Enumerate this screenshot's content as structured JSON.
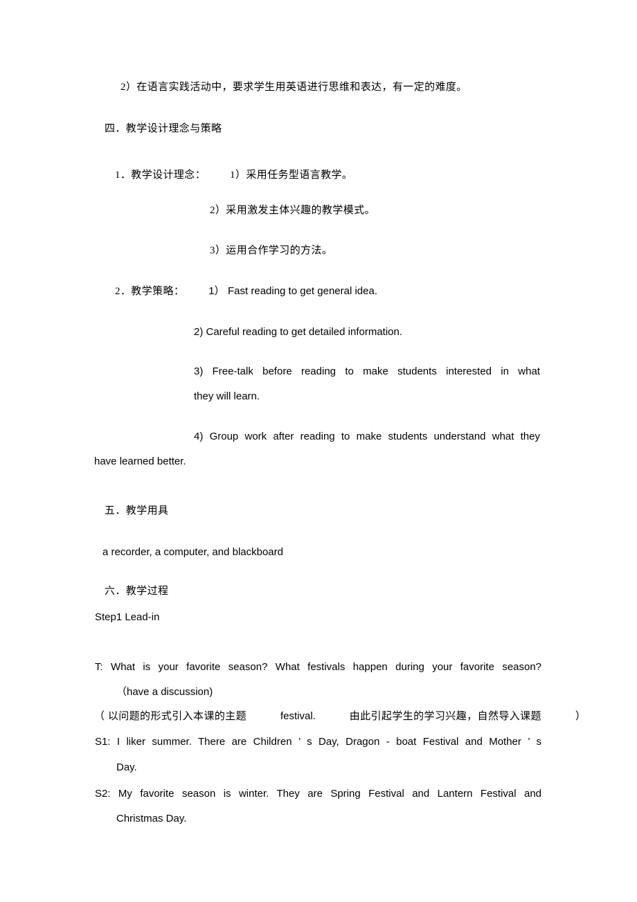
{
  "document": {
    "type": "lesson-plan",
    "language": "zh-CN + en",
    "page_background": "#ffffff",
    "text_color": "#000000"
  },
  "lines": {
    "difficulty_item2": "2）在语言实践活动中，要求学生用英语进行思维和表达，有一定的难度。",
    "section_four_heading": "四．教学设计理念与策略",
    "concept_label": "1．教学设计理念：",
    "concept_item1": "1）采用任务型语言教学。",
    "concept_item2": "2）采用激发主体兴趣的教学模式。",
    "concept_item3": "3）运用合作学习的方法。",
    "strategy_label": "2．教学策略：",
    "strategy_item1_num": "1）",
    "strategy_item1_text": "Fast reading to get general idea.",
    "strategy_item2": "2) Careful reading to get detailed information.",
    "strategy_item3_line1_words": [
      "3)",
      "Free-talk",
      "before",
      "reading",
      "to",
      "make",
      "students",
      "interested",
      "in",
      "what"
    ],
    "strategy_item3_line2": "they will learn.",
    "strategy_item4_line1_words": [
      "4)",
      "Group",
      "work",
      "after",
      "reading",
      "to",
      "make",
      "students",
      "understand",
      "what",
      "they"
    ],
    "strategy_item4_line2": "have learned better.",
    "section_five_heading": "五．教学用具",
    "teaching_aids": "a recorder, a computer, and blackboard",
    "section_six_heading": "六．教学过程",
    "step1_heading": "Step1 Lead-in",
    "teacher_line_words": [
      "T:",
      "What",
      "is",
      "your",
      "favorite",
      "season?",
      "What",
      "festivals",
      "happen",
      "during",
      "your",
      "favorite",
      "season?"
    ],
    "teacher_line2": "（have a discussion)",
    "note_open_paren": "（",
    "note_cn1": "以问题的形式引入本课的主题",
    "note_en": "festival.",
    "note_cn2": "由此引起学生的学习兴趣，自然导入课题",
    "note_close_paren": "）",
    "s1_line1_words": [
      "S1:",
      "I",
      "liker",
      "summer.",
      "There",
      "are",
      "Children",
      "’",
      "s",
      "Day,",
      "Dragon",
      "- boat",
      "Festival",
      "and",
      "Mother",
      "’",
      "s"
    ],
    "s1_line2": "Day.",
    "s2_line1_words": [
      "S2:",
      "My",
      "favorite",
      "season",
      "is",
      "winter.",
      "They",
      "are",
      "Spring",
      "Festival",
      "and",
      "Lantern",
      "Festival",
      "and"
    ],
    "s2_line2": "Christmas Day."
  }
}
